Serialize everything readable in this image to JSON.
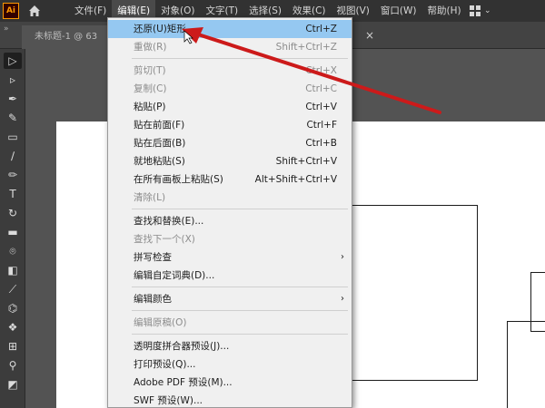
{
  "app": {
    "logo_text": "Ai"
  },
  "menubar": {
    "items": [
      "文件(F)",
      "编辑(E)",
      "对象(O)",
      "文字(T)",
      "选择(S)",
      "效果(C)",
      "视图(V)",
      "窗口(W)",
      "帮助(H)"
    ],
    "active_index": 1
  },
  "tabs": {
    "document": "未标题-1 @ 63"
  },
  "toolbar": {
    "icons": [
      "selection-tool-icon",
      "direct-selection-tool-icon",
      "pen-tool-icon",
      "curvature-tool-icon",
      "rectangle-tool-icon",
      "paintbrush-tool-icon",
      "pencil-tool-icon",
      "type-tool-icon",
      "rotate-tool-icon",
      "eraser-tool-icon",
      "lasso-tool-icon",
      "gradient-tool-icon",
      "eyedropper-tool-icon",
      "blend-tool-icon",
      "symbol-tool-icon",
      "artboard-tool-icon",
      "zoom-tool-icon",
      "fill-stroke-icon"
    ]
  },
  "edit_menu": {
    "items": [
      {
        "label": "还原(U)矩形",
        "shortcut": "Ctrl+Z",
        "state": "highlighted"
      },
      {
        "label": "重做(R)",
        "shortcut": "Shift+Ctrl+Z",
        "state": "disabled"
      },
      {
        "label": "剪切(T)",
        "shortcut": "Ctrl+X",
        "state": "disabled"
      },
      {
        "label": "复制(C)",
        "shortcut": "Ctrl+C",
        "state": "disabled"
      },
      {
        "label": "粘贴(P)",
        "shortcut": "Ctrl+V",
        "state": "enabled"
      },
      {
        "label": "贴在前面(F)",
        "shortcut": "Ctrl+F",
        "state": "enabled"
      },
      {
        "label": "贴在后面(B)",
        "shortcut": "Ctrl+B",
        "state": "enabled"
      },
      {
        "label": "就地粘贴(S)",
        "shortcut": "Shift+Ctrl+V",
        "state": "enabled"
      },
      {
        "label": "在所有画板上粘贴(S)",
        "shortcut": "Alt+Shift+Ctrl+V",
        "state": "enabled"
      },
      {
        "label": "清除(L)",
        "shortcut": "",
        "state": "disabled"
      },
      {
        "label": "查找和替换(E)...",
        "shortcut": "",
        "state": "enabled"
      },
      {
        "label": "查找下一个(X)",
        "shortcut": "",
        "state": "disabled"
      },
      {
        "label": "拼写检查",
        "shortcut": "",
        "state": "submenu"
      },
      {
        "label": "编辑自定词典(D)...",
        "shortcut": "",
        "state": "enabled"
      },
      {
        "label": "编辑颜色",
        "shortcut": "",
        "state": "submenu"
      },
      {
        "label": "编辑原稿(O)",
        "shortcut": "",
        "state": "disabled"
      },
      {
        "label": "透明度拼合器预设(J)...",
        "shortcut": "",
        "state": "enabled"
      },
      {
        "label": "打印预设(Q)...",
        "shortcut": "",
        "state": "enabled"
      },
      {
        "label": "Adobe PDF 预设(M)...",
        "shortcut": "",
        "state": "enabled"
      },
      {
        "label": "SWF 预设(W)...",
        "shortcut": "",
        "state": "enabled"
      }
    ],
    "submenu_glyph": "›"
  },
  "colors": {
    "highlight": "#95c8f1",
    "annotation_arrow": "#cc1a1a",
    "menubar_bg": "#323232",
    "logo_accent": "#ff9a00"
  }
}
